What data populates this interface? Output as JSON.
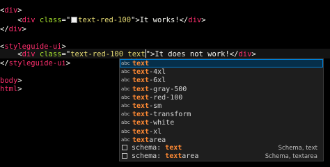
{
  "editor": {
    "lines": [
      {
        "indent": "",
        "parts": [
          {
            "c": "pun",
            "t": "<"
          },
          {
            "c": "tag",
            "t": "div"
          },
          {
            "c": "pun",
            "t": ">"
          }
        ]
      },
      {
        "indent": "    ",
        "parts": [
          {
            "c": "pun",
            "t": "<"
          },
          {
            "c": "tag",
            "t": "div"
          },
          {
            "c": "attr",
            "t": " class"
          },
          {
            "c": "pun",
            "t": "=\""
          },
          {
            "c": "swatch",
            "t": ""
          },
          {
            "c": "str",
            "t": "text-red-100"
          },
          {
            "c": "pun",
            "t": "\">"
          },
          {
            "c": "txt",
            "t": "It works!"
          },
          {
            "c": "pun",
            "t": "</"
          },
          {
            "c": "tag",
            "t": "div"
          },
          {
            "c": "pun",
            "t": ">"
          }
        ]
      },
      {
        "indent": "",
        "parts": [
          {
            "c": "pun",
            "t": "</"
          },
          {
            "c": "tag",
            "t": "div"
          },
          {
            "c": "pun",
            "t": ">"
          }
        ]
      },
      {
        "indent": "",
        "parts": []
      },
      {
        "indent": "",
        "parts": [
          {
            "c": "pun",
            "t": "<"
          },
          {
            "c": "tag",
            "t": "styleguide-ui"
          },
          {
            "c": "pun",
            "t": ">"
          }
        ]
      },
      {
        "indent": "    ",
        "parts": [
          {
            "c": "pun",
            "t": "<"
          },
          {
            "c": "tag",
            "t": "div"
          },
          {
            "c": "attr",
            "t": " class"
          },
          {
            "c": "pun",
            "t": "=\""
          },
          {
            "c": "str",
            "t": "text-red-100 "
          },
          {
            "c": "strsq",
            "t": "text"
          },
          {
            "c": "cursor",
            "t": ""
          },
          {
            "c": "pun",
            "t": "\">"
          },
          {
            "c": "txt",
            "t": "It does not work!"
          },
          {
            "c": "pun",
            "t": "</"
          },
          {
            "c": "tag",
            "t": "div"
          },
          {
            "c": "pun",
            "t": ">"
          }
        ]
      },
      {
        "indent": "",
        "parts": [
          {
            "c": "pun",
            "t": "</"
          },
          {
            "c": "tag",
            "t": "styleguide-ui"
          },
          {
            "c": "pun",
            "t": ">"
          }
        ]
      },
      {
        "indent": "",
        "parts": []
      },
      {
        "indent": "",
        "parts": [
          {
            "c": "tag",
            "t": "body"
          },
          {
            "c": "pun",
            "t": ">"
          }
        ]
      },
      {
        "indent": "",
        "parts": [
          {
            "c": "tag",
            "t": "html"
          },
          {
            "c": "pun",
            "t": ">"
          }
        ]
      }
    ]
  },
  "suggest": {
    "items": [
      {
        "kind": "abc",
        "match": "text",
        "rest": "",
        "detail": "",
        "selected": true
      },
      {
        "kind": "abc",
        "match": "text",
        "rest": "-4xl",
        "detail": "",
        "selected": false
      },
      {
        "kind": "abc",
        "match": "text",
        "rest": "-6xl",
        "detail": "",
        "selected": false
      },
      {
        "kind": "abc",
        "match": "text",
        "rest": "-gray-500",
        "detail": "",
        "selected": false
      },
      {
        "kind": "abc",
        "match": "text",
        "rest": "-red-100",
        "detail": "",
        "selected": false
      },
      {
        "kind": "abc",
        "match": "text",
        "rest": "-sm",
        "detail": "",
        "selected": false
      },
      {
        "kind": "abc",
        "match": "text",
        "rest": "-transform",
        "detail": "",
        "selected": false
      },
      {
        "kind": "abc",
        "match": "text",
        "rest": "-white",
        "detail": "",
        "selected": false
      },
      {
        "kind": "abc",
        "match": "text",
        "rest": "-xl",
        "detail": "",
        "selected": false
      },
      {
        "kind": "abc",
        "match": "text",
        "rest": "area",
        "detail": "",
        "selected": false
      },
      {
        "kind": "box",
        "prefix": "schema: ",
        "match": "text",
        "rest": "",
        "detail": "Schema, text",
        "selected": false
      },
      {
        "kind": "box",
        "prefix": "schema: ",
        "match": "text",
        "rest": "area",
        "detail": "Schema, textarea",
        "selected": false
      }
    ]
  },
  "colors": {
    "tag": "#ff2f6e",
    "attr": "#a6e22e",
    "string": "#e6db74",
    "match_highlight": "#ff8a34",
    "selection": "#062f4a"
  }
}
